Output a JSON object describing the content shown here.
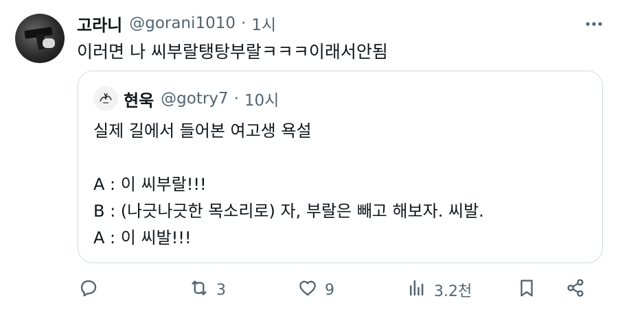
{
  "tweet": {
    "author_name": "고라니",
    "author_handle": "@gorani1010",
    "separator": "·",
    "time": "1시",
    "text": "이러면 나 씨부랄탱탕부랄ㅋㅋㅋ이래서안됨"
  },
  "quoted": {
    "author_name": "현욱",
    "author_handle": "@gotry7",
    "separator": "·",
    "time": "10시",
    "lines": [
      "실제 길에서 들어본 여고생 욕설",
      "",
      "A : 이 씨부랄!!!",
      "B : (나긋나긋한 목소리로) 자, 부랄은 빼고 해보자. 씨발.",
      "A : 이 씨발!!!"
    ]
  },
  "actions": {
    "reply": {
      "icon": "reply-icon",
      "count": ""
    },
    "retweet": {
      "icon": "retweet-icon",
      "count": "3"
    },
    "like": {
      "icon": "heart-icon",
      "count": "9"
    },
    "views": {
      "icon": "views-icon",
      "count": "3.2천"
    },
    "bookmark": {
      "icon": "bookmark-icon"
    },
    "share": {
      "icon": "share-icon"
    }
  },
  "colors": {
    "text": "#0f1419",
    "secondary": "#536471",
    "border": "#cfd9de"
  }
}
